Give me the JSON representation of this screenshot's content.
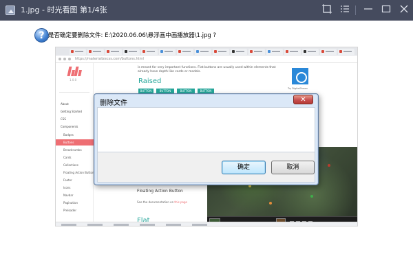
{
  "window": {
    "title": "1.jpg - 时光看图 第1/4张",
    "colors": {
      "titlebar": "#454b5e",
      "accent": "#26a69a",
      "brand": "#ee6e73"
    },
    "icons": [
      "crop-icon",
      "list-icon",
      "minimize-icon",
      "maximize-icon",
      "close-icon"
    ]
  },
  "browser": {
    "url": "https://materializecss.com/buttons.html",
    "sidebar": {
      "logo_caption": "1.0.0",
      "items": [
        "About",
        "Getting Started",
        "CSS",
        "Components",
        "Badges",
        "Buttons",
        "Breadcrumbs",
        "Cards",
        "Collections",
        "Floating Action Button",
        "Footer",
        "Icons",
        "Navbar",
        "Pagination",
        "Preloader"
      ]
    },
    "intro_text": "is meant for very important functions. Flat buttons are usually used within elements that already have depth like cards or modals.",
    "raised_heading": "Raised",
    "raised_buttons": [
      "BUTTON",
      "BUTTON",
      "BUTTON",
      "BUTTON"
    ],
    "ad_label": "Try DigitalOcean",
    "fab_heading": "Floating Action Button",
    "fab_doc": "See the documentation on",
    "fab_doc_link": "this page",
    "flat_heading": "Flat"
  },
  "dialog": {
    "title": "删除文件",
    "close_label": "✕",
    "icon": "question-icon",
    "message": "是否确定要删除文件: E:\\2020.06.06\\悬浮画中画播放器\\1.jpg ?",
    "ok_label": "确定",
    "cancel_label": "取消"
  }
}
